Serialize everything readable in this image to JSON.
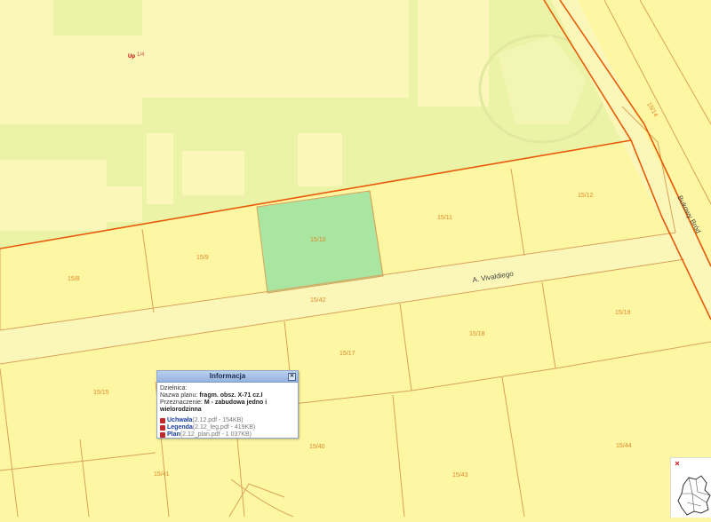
{
  "map": {
    "zone_label": "Up",
    "zone_sub": "1/4",
    "street_a": "A. Vivaldiego",
    "street_b": "Bukowy Bród",
    "parcels": [
      "15/8",
      "15/9",
      "15/10",
      "15/11",
      "15/12",
      "15/42",
      "15/17",
      "15/18",
      "15/19",
      "15/15",
      "15/41",
      "15/43",
      "15/44",
      "15/40",
      "15/14"
    ],
    "colors": {
      "background": "#fdf6a3",
      "green_strip": "#e8f2a2",
      "selected": "#a9e6a2",
      "boundary": "#e85a0a",
      "parcel_line": "#d9a35a"
    }
  },
  "popup": {
    "title": "Informacja",
    "close": "✕",
    "district_label": "Dzielnica:",
    "plan_label": "Nazwa planu:",
    "plan_value": "fragm. obsz. X-71 cz.I",
    "purpose_label": "Przeznaczenie:",
    "purpose_value": "M - zabudowa jedno i wielorodzinna",
    "docs": [
      {
        "name": "Uchwała",
        "meta": "(2.12.pdf - 154KB)"
      },
      {
        "name": "Legenda",
        "meta": "(2.12_leg.pdf - 419KB)"
      },
      {
        "name": "Plan",
        "meta": "(2.12_plan.pdf - 1 037KB)"
      }
    ]
  }
}
